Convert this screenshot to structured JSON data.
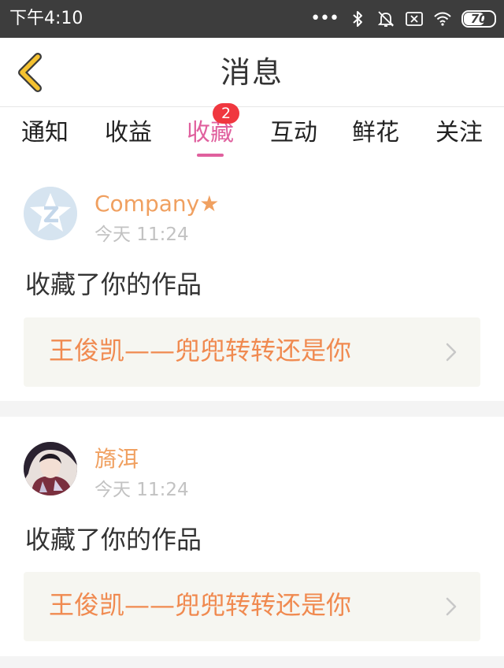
{
  "status_bar": {
    "time": "下午4:10",
    "dots": "•••",
    "battery": "70",
    "battery_level_percent": 70,
    "icons": [
      "bluetooth-icon",
      "notifications-off-icon",
      "sim-card-icon",
      "wifi-icon",
      "battery-icon"
    ]
  },
  "header": {
    "title": "消息",
    "back_icon": "chevron-left-icon"
  },
  "tabs": [
    {
      "label": "通知",
      "active": false
    },
    {
      "label": "收益",
      "active": false
    },
    {
      "label": "收藏",
      "active": true,
      "badge": "2"
    },
    {
      "label": "互动",
      "active": false
    },
    {
      "label": "鲜花",
      "active": false
    },
    {
      "label": "关注",
      "active": false
    }
  ],
  "messages": [
    {
      "sender": "Company★",
      "time": "今天 11:24",
      "action": "收藏了你的作品",
      "work_title": "王俊凯——兜兜转转还是你",
      "avatar": "default-avatar-icon"
    },
    {
      "sender": "旖洱",
      "time": "今天 11:24",
      "action": "收藏了你的作品",
      "work_title": "王俊凯——兜兜转转还是你",
      "avatar": "user-photo-avatar"
    }
  ],
  "colors": {
    "accent_pink": "#e0609e",
    "sender_orange": "#f0a060",
    "work_orange": "#f08a50",
    "badge_red": "#f0373f",
    "status_bar_bg": "#3d3d3d",
    "back_yellow": "#f5c230"
  }
}
